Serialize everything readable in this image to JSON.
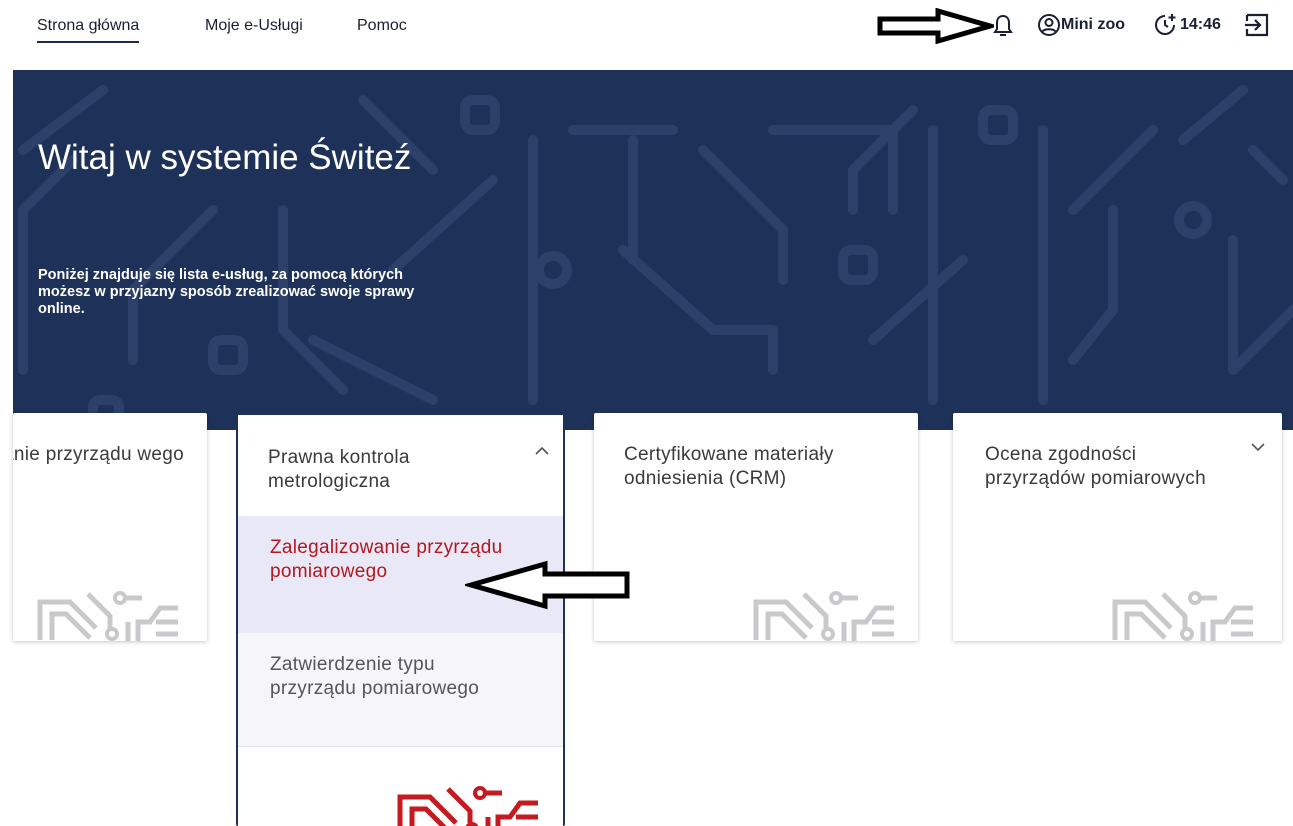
{
  "nav": {
    "home": "Strona główna",
    "services": "Moje e-Usługi",
    "help": "Pomoc"
  },
  "header": {
    "username": "Mini zoo",
    "session_time": "14:46",
    "icons": [
      "arrow-right-annotation-icon",
      "bell-icon",
      "user-circle-icon",
      "timer-icon",
      "logout-icon"
    ]
  },
  "hero": {
    "title": "Witaj w systemie Świteź",
    "description": "Poniżej znajduje się lista e-usług, za pomocą których możesz w przyjazny sposób zrealizować swoje sprawy online."
  },
  "cards": [
    {
      "title": "anie przyrządu wego"
    },
    {
      "title": "Prawna kontrola metrologiczna",
      "expanded": true,
      "items": [
        {
          "label": "Zalegalizowanie przyrządu pomiarowego",
          "selected": true
        },
        {
          "label": "Zatwierdzenie typu przyrządu pomiarowego",
          "selected": false
        }
      ]
    },
    {
      "title": "Certyfikowane materiały odniesienia (CRM)"
    },
    {
      "title": "Ocena zgodności przyrządów pomiarowych",
      "expanded": false
    }
  ],
  "colors": {
    "hero_bg": "#1e3158",
    "selected_text": "#b3171f",
    "selected_bg": "#e8e8f6",
    "deco_gray": "#c9c9cc",
    "deco_red": "#c41a20"
  }
}
